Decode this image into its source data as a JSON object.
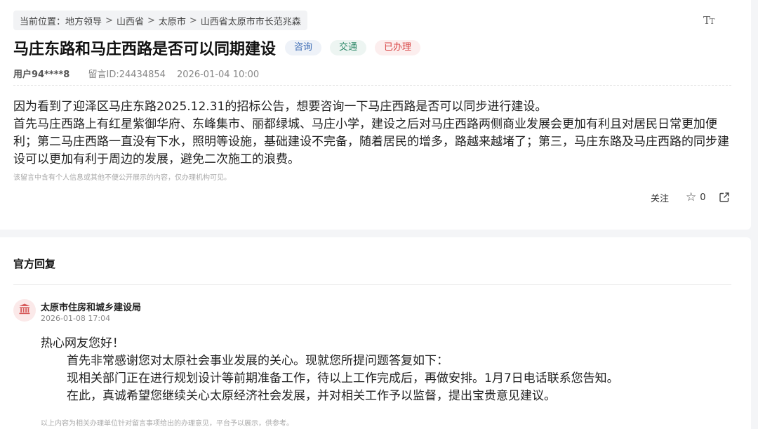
{
  "breadcrumb": {
    "prefix": "当前位置：",
    "items": [
      "地方领导",
      "山西省",
      "太原市",
      "山西省太原市市长范兆森"
    ],
    "separator": ">"
  },
  "toolbar": {
    "font_size_glyph": "T",
    "font_size_glyph_small": "T"
  },
  "message": {
    "title": "马庄东路和马庄西路是否可以同期建设",
    "tags": [
      "咨询",
      "交通",
      "已办理"
    ],
    "user": "用户94****8",
    "message_id": "留言ID:24434854",
    "time": "2026-01-04 10:00",
    "paragraphs": [
      "因为看到了迎泽区马庄东路2025.12.31的招标公告，想要咨询一下马庄西路是否可以同步进行建设。",
      "首先马庄西路上有红星紫御华府、东峰集市、丽都绿城、马庄小学，建设之后对马庄西路两侧商业发展会更加有利且对居民日常更加便利；第二马庄西路一直没有下水，照明等设施，基础建设不完备，随着居民的增多，路越来越堵了；第三，马庄东路及马庄西路的同步建设可以更加有利于周边的发展，避免二次施工的浪费。"
    ],
    "privacy_note": "该留言中含有个人信息或其他不便公开展示的内容，仅办理机构可见。",
    "follow_label": "关注",
    "star_count": "0"
  },
  "reply": {
    "section_title": "官方回复",
    "org_name": "太原市住房和城乡建设局",
    "time": "2026-01-08 17:04",
    "greeting": "热心网友您好！",
    "lines": [
      "首先非常感谢您对太原社会事业发展的关心。现就您所提问题答复如下：",
      "现相关部门正在进行规划设计等前期准备工作，待以上工作完成后，再做安排。1月7日电话联系您告知。",
      "在此，真诚希望您继续关心太原经济社会发展，并对相关工作予以监督，提出宝贵意见建议。"
    ],
    "disclaimer": "以上内容为相关办理单位针对留言事项给出的办理意见，平台予以展示，供参考。"
  },
  "colors": {
    "tag_consult": "#3e6db5",
    "tag_traffic": "#2f8a6a",
    "tag_done": "#d84444",
    "avatar_bg": "#fbe9e9",
    "avatar_icon": "#d65a5a"
  }
}
